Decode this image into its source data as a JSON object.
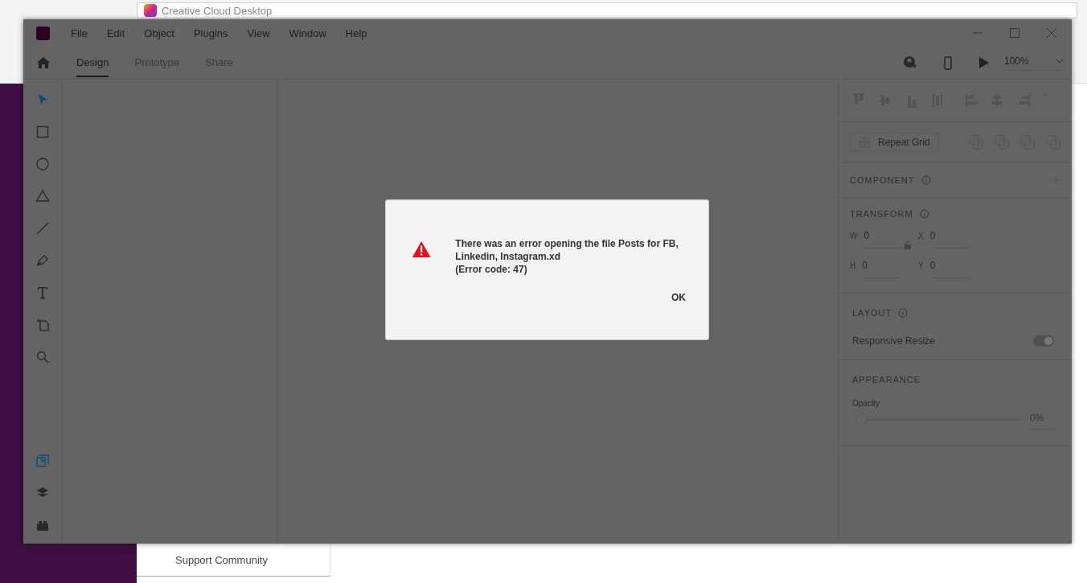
{
  "browser": {
    "tab_title": "Creative Cloud Desktop",
    "support_link": "Support Community"
  },
  "window": {
    "menu": [
      "File",
      "Edit",
      "Object",
      "Plugins",
      "View",
      "Window",
      "Help"
    ]
  },
  "tabs": [
    {
      "label": "Design",
      "selected": true
    },
    {
      "label": "Prototype",
      "selected": false
    },
    {
      "label": "Share",
      "selected": false
    }
  ],
  "zoom": "100%",
  "tools": [
    {
      "kind": "select",
      "selected": true
    },
    {
      "kind": "rectangle",
      "selected": false
    },
    {
      "kind": "ellipse",
      "selected": false
    },
    {
      "kind": "polygon",
      "selected": false
    },
    {
      "kind": "line",
      "selected": false
    },
    {
      "kind": "pen",
      "selected": false
    },
    {
      "kind": "text",
      "selected": false
    },
    {
      "kind": "artboard",
      "selected": false
    },
    {
      "kind": "zoom",
      "selected": false
    }
  ],
  "panels": [
    {
      "kind": "assets",
      "selected": true
    },
    {
      "kind": "layers",
      "selected": false
    },
    {
      "kind": "plugins",
      "selected": false
    }
  ],
  "inspector": {
    "repeat_grid": "Repeat Grid",
    "component": {
      "title": "COMPONENT"
    },
    "transform": {
      "title": "TRANSFORM",
      "fields": [
        {
          "label": "W",
          "value": "0"
        },
        {
          "label": "X",
          "value": "0"
        },
        {
          "label": "H",
          "value": "0"
        },
        {
          "label": "Y",
          "value": "0"
        }
      ]
    },
    "layout": {
      "title": "LAYOUT",
      "responsive_resize": {
        "label": "Responsive Resize",
        "on": true
      }
    },
    "appearance": {
      "title": "APPEARANCE",
      "opacity": {
        "label": "Opacity",
        "level": 0,
        "reading": "0%"
      }
    }
  },
  "dialog": {
    "message": "There was an error opening the file Posts for FB, Linkedin, Instagram.xd",
    "code": "(Error code: 47)",
    "button": "OK"
  }
}
